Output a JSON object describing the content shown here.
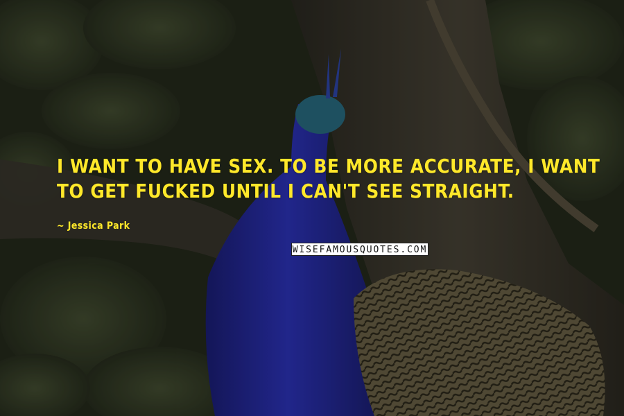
{
  "quote": {
    "lines": [
      "I want to have sex. To be more accurate, I want",
      "to get fucked until I can't see straight."
    ]
  },
  "author": "~ Jessica Park",
  "watermark": "WISEFAMOUSQUOTES.COM",
  "colors": {
    "quote_text": "#ffe82a",
    "background_foliage": "#3a4329",
    "peacock_body": "#2b2fb2"
  }
}
